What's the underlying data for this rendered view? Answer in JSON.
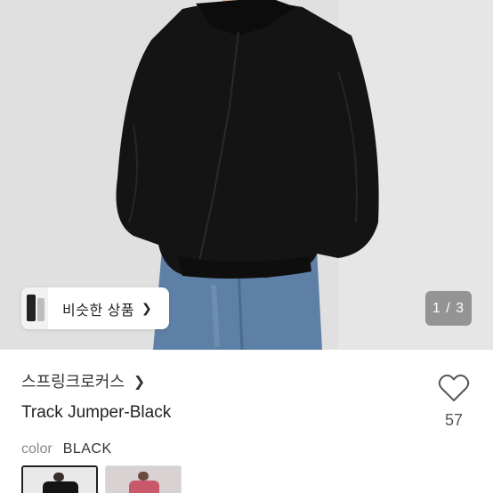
{
  "gallery": {
    "similar_label": "비슷한 상품",
    "page_counter": "1 / 3"
  },
  "product": {
    "brand": "스프링크로커스",
    "title": "Track Jumper-Black",
    "likes": "57",
    "color_label": "color",
    "color_value": "BLACK"
  },
  "icons": {
    "similar_chevron": "chevron-right-icon",
    "brand_chevron": "chevron-right-icon",
    "like": "heart-outline-icon"
  },
  "colors": {
    "jacket": "#141414",
    "jeans": "#5d7ea3",
    "counter_bg": "#7b7b7b",
    "variant_pink": "#c9586a"
  }
}
